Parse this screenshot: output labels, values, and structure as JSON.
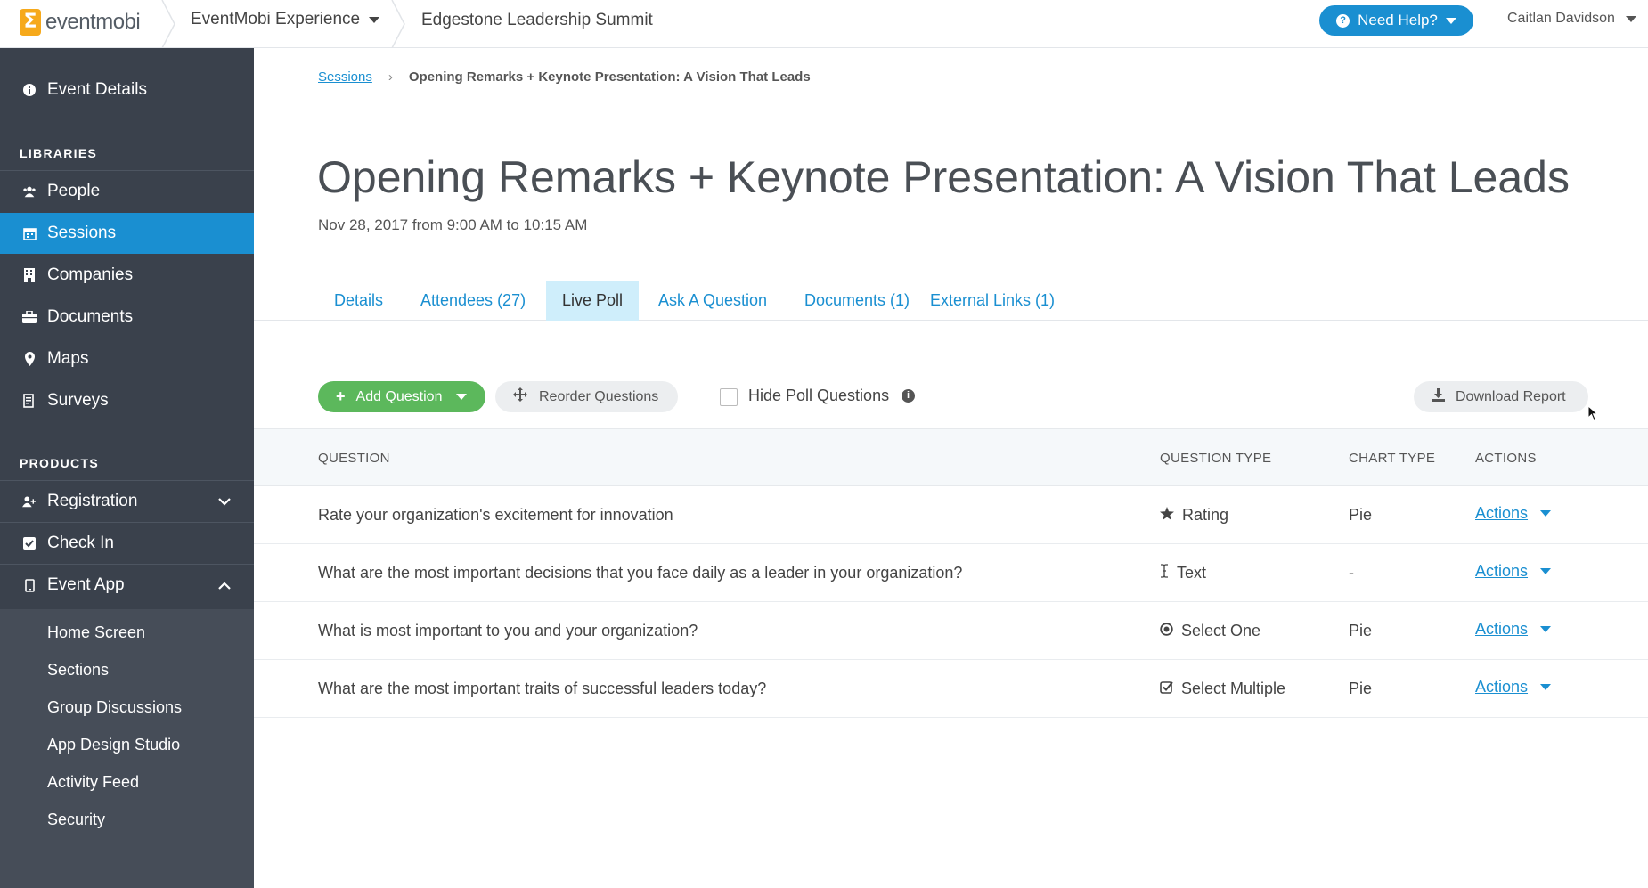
{
  "header": {
    "logo_text": "eventmobi",
    "app_name": "EventMobi Experience",
    "event_name": "Edgestone Leadership Summit",
    "help_label": "Need Help?",
    "user_name": "Caitlan Davidson",
    "accent_color": "#1a8fd1"
  },
  "sidebar": {
    "event_details": "Event Details",
    "libraries_heading": "LIBRARIES",
    "libraries": [
      {
        "label": "People",
        "icon": "people-icon"
      },
      {
        "label": "Sessions",
        "icon": "calendar-icon",
        "active": true
      },
      {
        "label": "Companies",
        "icon": "building-icon"
      },
      {
        "label": "Documents",
        "icon": "briefcase-icon"
      },
      {
        "label": "Maps",
        "icon": "map-pin-icon"
      },
      {
        "label": "Surveys",
        "icon": "survey-icon"
      }
    ],
    "products_heading": "PRODUCTS",
    "products": [
      {
        "label": "Registration",
        "icon": "user-plus-icon"
      },
      {
        "label": "Check In",
        "icon": "checkbox-icon"
      },
      {
        "label": "Event App",
        "icon": "phone-icon"
      }
    ],
    "event_app_items": [
      "Home Screen",
      "Sections",
      "Group Discussions",
      "App Design Studio",
      "Activity Feed",
      "Security"
    ]
  },
  "breadcrumb": {
    "root": "Sessions",
    "current": "Opening Remarks + Keynote Presentation: A Vision That Leads"
  },
  "page": {
    "title": "Opening Remarks + Keynote Presentation: A Vision That Leads",
    "subtitle": "Nov 28, 2017 from 9:00 AM to 10:15 AM"
  },
  "tabs": [
    {
      "label": "Details"
    },
    {
      "label": "Attendees (27)"
    },
    {
      "label": "Live Poll",
      "active": true
    },
    {
      "label": "Ask A Question"
    },
    {
      "label": "Documents (1)"
    },
    {
      "label": "External Links (1)"
    }
  ],
  "toolbar": {
    "add_question": "Add Question",
    "reorder_questions": "Reorder Questions",
    "hide_poll_questions": "Hide Poll Questions",
    "hide_poll_checked": false,
    "download_report": "Download Report"
  },
  "table": {
    "columns": [
      "QUESTION",
      "QUESTION TYPE",
      "CHART TYPE",
      "ACTIONS"
    ],
    "rows": [
      {
        "question": "Rate your organization's excitement for innovation",
        "type": "Rating",
        "type_icon": "star-icon",
        "chart": "Pie",
        "action": "Actions"
      },
      {
        "question": "What are the most important decisions that you face daily as a leader in your organization?",
        "type": "Text",
        "type_icon": "text-cursor-icon",
        "chart": "-",
        "action": "Actions"
      },
      {
        "question": "What is most important to you and your organization?",
        "type": "Select One",
        "type_icon": "radio-icon",
        "chart": "Pie",
        "action": "Actions"
      },
      {
        "question": "What are the most important traits of successful leaders today?",
        "type": "Select Multiple",
        "type_icon": "checkbox-icon",
        "chart": "Pie",
        "action": "Actions"
      }
    ]
  }
}
